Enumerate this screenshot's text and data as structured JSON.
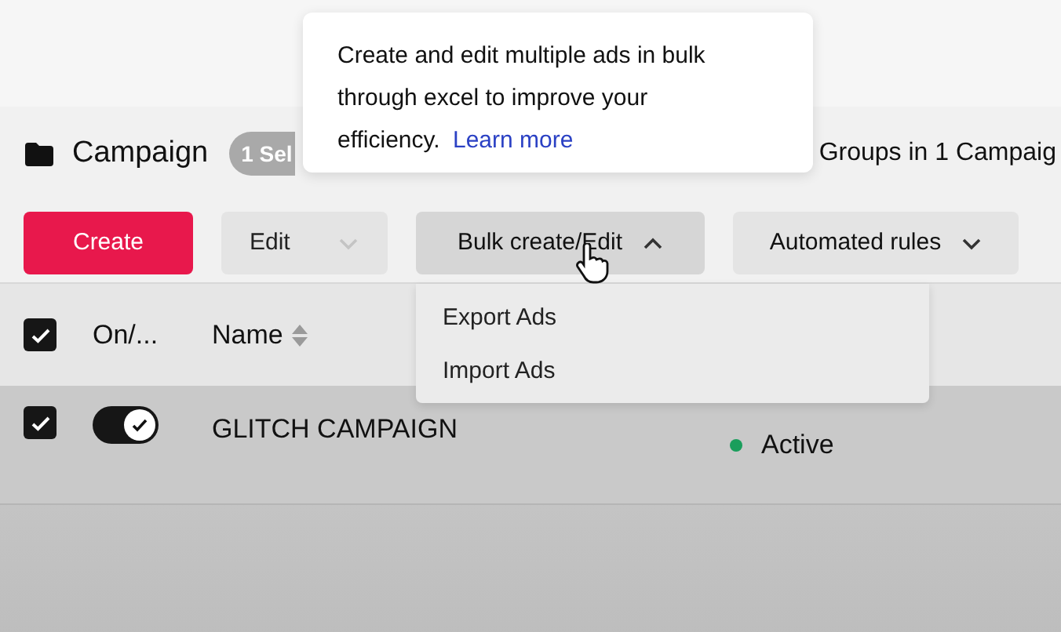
{
  "tooltip": {
    "text": "Create and edit multiple ads in bulk through excel to improve your efficiency.",
    "link": "Learn more"
  },
  "header": {
    "title": "Campaign",
    "selection_badge": "1 Sel",
    "summary": "Groups in 1 Campaig"
  },
  "toolbar": [
    {
      "label": "Create",
      "kind": "primary"
    },
    {
      "label": "Edit",
      "kind": "dropdown",
      "expanded": false,
      "disabled": true
    },
    {
      "label": "Bulk create/Edit",
      "kind": "dropdown",
      "expanded": true,
      "disabled": false
    },
    {
      "label": "Automated rules",
      "kind": "dropdown",
      "expanded": false,
      "disabled": false
    }
  ],
  "menu": [
    "Export Ads",
    "Import Ads"
  ],
  "table": {
    "select_all_checked": true,
    "columns": [
      "On/...",
      "Name"
    ],
    "rows": [
      {
        "checked": true,
        "on": true,
        "name": "GLITCH CAMPAIGN",
        "status": "Active",
        "color": "#1a9e5c"
      }
    ]
  }
}
